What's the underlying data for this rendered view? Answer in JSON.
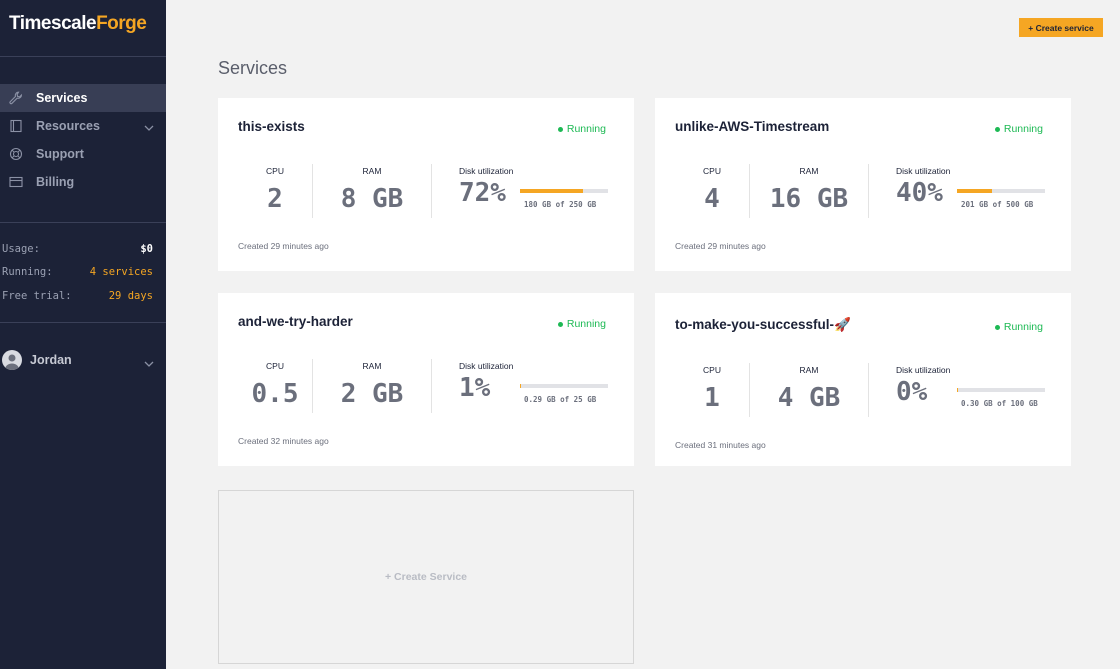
{
  "brand": {
    "part1": "Timescale",
    "part2": "Forge"
  },
  "nav": [
    {
      "label": "Services",
      "icon": "wrench-icon",
      "active": true
    },
    {
      "label": "Resources",
      "icon": "book-icon",
      "expandable": true
    },
    {
      "label": "Support",
      "icon": "lifebuoy-icon"
    },
    {
      "label": "Billing",
      "icon": "credit-card-icon"
    }
  ],
  "stats": {
    "usage_label": "Usage:",
    "usage_value": "$0",
    "running_label": "Running:",
    "running_value": "4 services",
    "trial_label": "Free trial:",
    "trial_value": "29 days"
  },
  "user": {
    "name": "Jordan"
  },
  "header": {
    "create_button": "+ Create service",
    "title": "Services"
  },
  "metric_labels": {
    "cpu": "CPU",
    "ram": "RAM",
    "disk": "Disk utilization"
  },
  "services": [
    {
      "name": "this-exists",
      "status": "Running",
      "cpu": "2",
      "ram": "8 GB",
      "disk_pct": "72%",
      "disk_fraction": 0.72,
      "disk_text": "180 GB of 250 GB",
      "created": "Created 29 minutes ago"
    },
    {
      "name": "unlike-AWS-Timestream",
      "status": "Running",
      "cpu": "4",
      "ram": "16 GB",
      "disk_pct": "40%",
      "disk_fraction": 0.4,
      "disk_text": "201 GB of 500 GB",
      "created": "Created 29 minutes ago"
    },
    {
      "name": "and-we-try-harder",
      "status": "Running",
      "cpu": "0.5",
      "ram": "2 GB",
      "disk_pct": "1%",
      "disk_fraction": 0.01,
      "disk_text": "0.29 GB of 25 GB",
      "created": "Created 32 minutes ago"
    },
    {
      "name": "to-make-you-successful-🚀",
      "status": "Running",
      "cpu": "1",
      "ram": "4 GB",
      "disk_pct": "0%",
      "disk_fraction": 0.003,
      "disk_text": "0.30 GB of 100 GB",
      "created": "Created 31 minutes ago"
    }
  ],
  "new_service_label": "+ Create Service",
  "colors": {
    "accent": "#f5a623",
    "sidebar": "#1c2237",
    "running": "#1db954"
  }
}
